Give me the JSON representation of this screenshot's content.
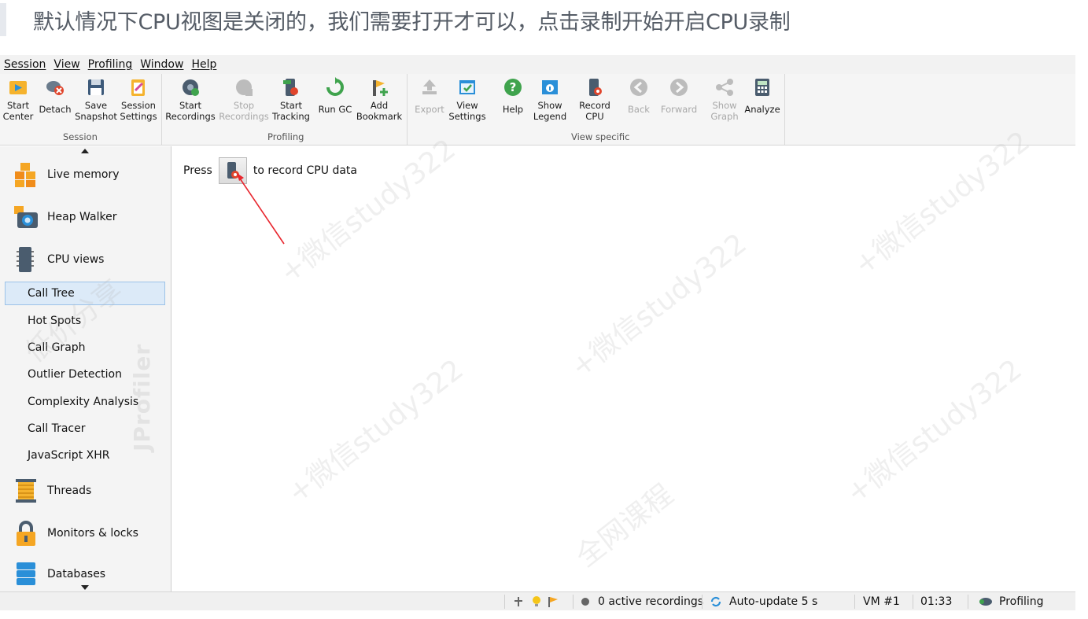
{
  "caption": "默认情况下CPU视图是关闭的，我们需要打开才可以，点击录制开始开启CPU录制",
  "menu": [
    "Session",
    "View",
    "Profiling",
    "Window",
    "Help"
  ],
  "toolbar": {
    "session": {
      "group_label": "Session",
      "buttons": [
        {
          "label": "Start\nCenter",
          "icon": "start-center-icon",
          "enabled": true
        },
        {
          "label": "Detach",
          "icon": "detach-icon",
          "enabled": true
        },
        {
          "label": "Save\nSnapshot",
          "icon": "save-snapshot-icon",
          "enabled": true
        },
        {
          "label": "Session\nSettings",
          "icon": "session-settings-icon",
          "enabled": true
        }
      ]
    },
    "profiling": {
      "group_label": "Profiling",
      "buttons": [
        {
          "label": "Start\nRecordings",
          "icon": "start-recordings-icon",
          "enabled": true
        },
        {
          "label": "Stop\nRecordings",
          "icon": "stop-recordings-icon",
          "enabled": false
        },
        {
          "label": "Start\nTracking",
          "icon": "start-tracking-icon",
          "enabled": true
        },
        {
          "label": "Run GC",
          "icon": "run-gc-icon",
          "enabled": true
        },
        {
          "label": "Add\nBookmark",
          "icon": "add-bookmark-icon",
          "enabled": true
        }
      ]
    },
    "view_specific": {
      "group_label": "View specific",
      "buttons": [
        {
          "label": "Export",
          "icon": "export-icon",
          "enabled": false
        },
        {
          "label": "View\nSettings",
          "icon": "view-settings-icon",
          "enabled": true
        },
        {
          "label": "Help",
          "icon": "help-icon",
          "enabled": true
        },
        {
          "label": "Show\nLegend",
          "icon": "show-legend-icon",
          "enabled": true
        },
        {
          "label": "Record\nCPU",
          "icon": "record-cpu-icon",
          "enabled": true
        },
        {
          "label": "Back",
          "icon": "back-icon",
          "enabled": false
        },
        {
          "label": "Forward",
          "icon": "forward-icon",
          "enabled": false
        },
        {
          "label": "Show\nGraph",
          "icon": "show-graph-icon",
          "enabled": false
        },
        {
          "label": "Analyze",
          "icon": "analyze-icon",
          "enabled": true
        }
      ]
    }
  },
  "sidebar": {
    "sections": [
      {
        "label": "Live memory",
        "icon": "live-memory-icon"
      },
      {
        "label": "Heap Walker",
        "icon": "heap-walker-icon"
      },
      {
        "label": "CPU views",
        "icon": "cpu-views-icon"
      },
      {
        "label": "Threads",
        "icon": "threads-icon"
      },
      {
        "label": "Monitors & locks",
        "icon": "monitors-locks-icon"
      },
      {
        "label": "Databases",
        "icon": "databases-icon"
      }
    ],
    "cpu_items": [
      "Call Tree",
      "Hot Spots",
      "Call Graph",
      "Outlier Detection",
      "Complexity Analysis",
      "Call Tracer",
      "JavaScript XHR"
    ],
    "selected_item": "Call Tree",
    "brand": "JProfiler"
  },
  "content": {
    "press_prefix": "Press",
    "press_suffix": "to record CPU data"
  },
  "statusbar": {
    "recordings": "0 active recordings",
    "auto_update": "Auto-update 5 s",
    "vm": "VM #1",
    "time": "01:33",
    "mode": "Profiling"
  },
  "watermarks": [
    "+微信study322",
    "低价分享",
    "全网课程"
  ],
  "colors": {
    "accent_selected": "#dceaf8",
    "annotation_arrow": "#e8262e"
  }
}
